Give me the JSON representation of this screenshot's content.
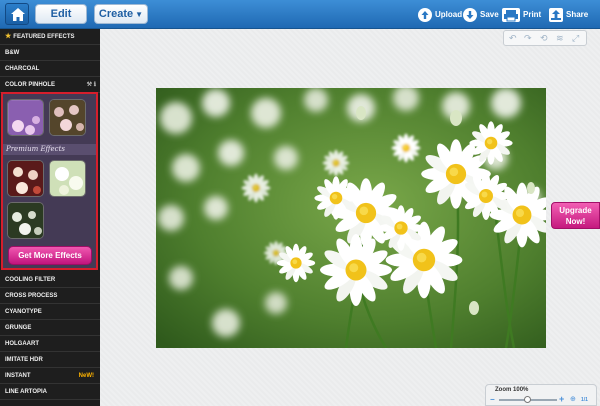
{
  "toolbar": {
    "edit_label": "Edit",
    "create_label": "Create",
    "actions": {
      "upload": "Upload",
      "save": "Save",
      "print": "Print",
      "share": "Share"
    }
  },
  "sidebar": {
    "items": [
      "FEATURED EFFECTS",
      "B&W",
      "CHARCOAL",
      "COLOR PINHOLE",
      "COOLING FILTER",
      "CROSS PROCESS",
      "CYANOTYPE",
      "GRUNGE",
      "HOLGAART",
      "IMITATE HDR",
      "INSTANT",
      "LINE ARTOPIA"
    ],
    "new_badge": "NeW!",
    "premium_label": "Premium Effects",
    "get_more_label": "Get More Effects"
  },
  "upgrade": {
    "line1": "Upgrade",
    "line2": "Now!"
  },
  "zoom": {
    "label": "Zoom",
    "value": "100%",
    "ratio": "1/1",
    "level": 0.5
  },
  "colors": {
    "topbar": "#2a78c4",
    "accent_pink": "#d8288f",
    "highlight_red": "#d61e2c",
    "sidebar_bg": "#1e1e1e"
  }
}
